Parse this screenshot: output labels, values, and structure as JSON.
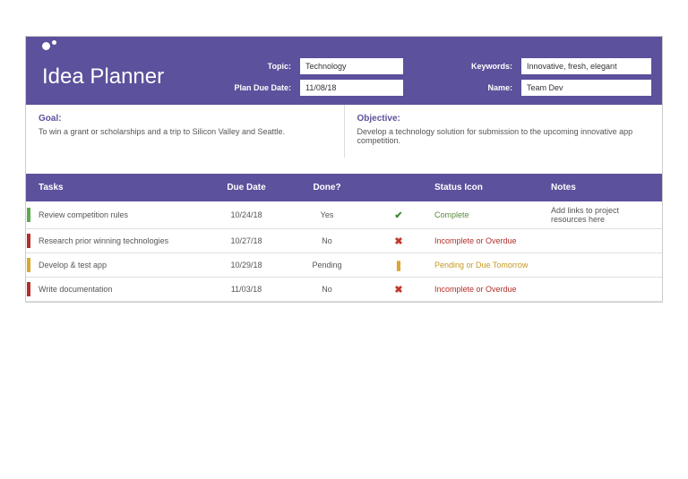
{
  "title": "Idea Planner",
  "meta": {
    "topic_label": "Topic:",
    "topic_value": "Technology",
    "keywords_label": "Keywords:",
    "keywords_value": "Innovative, fresh, elegant",
    "due_label": "Plan Due Date:",
    "due_value": "11/08/18",
    "name_label": "Name:",
    "name_value": "Team Dev"
  },
  "goal": {
    "heading": "Goal:",
    "text": "To win a grant or scholarships and a trip to Silicon Valley and Seattle."
  },
  "objective": {
    "heading": "Objective:",
    "text": "Develop a technology solution for submission to the upcoming innovative app competition."
  },
  "columns": {
    "tasks": "Tasks",
    "due": "Due Date",
    "done": "Done?",
    "icon": "Status Icon",
    "notes": "Notes"
  },
  "rows": [
    {
      "task": "Review competition rules",
      "due": "10/24/18",
      "done": "Yes",
      "icon": "✔",
      "iconClass": "ic-green",
      "status": "Complete",
      "statusClass": "st-green",
      "stripe": "c-green",
      "notes": "Add links to project resources here"
    },
    {
      "task": "Research prior winning technologies",
      "due": "10/27/18",
      "done": "No",
      "icon": "✖",
      "iconClass": "ic-red",
      "status": "Incomplete or Overdue",
      "statusClass": "st-red",
      "stripe": "c-red",
      "notes": ""
    },
    {
      "task": "Develop & test app",
      "due": "10/29/18",
      "done": "Pending",
      "icon": "❚",
      "iconClass": "ic-yellow",
      "status": "Pending or Due Tomorrow",
      "statusClass": "st-yellow",
      "stripe": "c-yellow",
      "notes": ""
    },
    {
      "task": "Write documentation",
      "due": "11/03/18",
      "done": "No",
      "icon": "✖",
      "iconClass": "ic-red",
      "status": "Incomplete or Overdue",
      "statusClass": "st-red",
      "stripe": "c-red",
      "notes": ""
    }
  ]
}
